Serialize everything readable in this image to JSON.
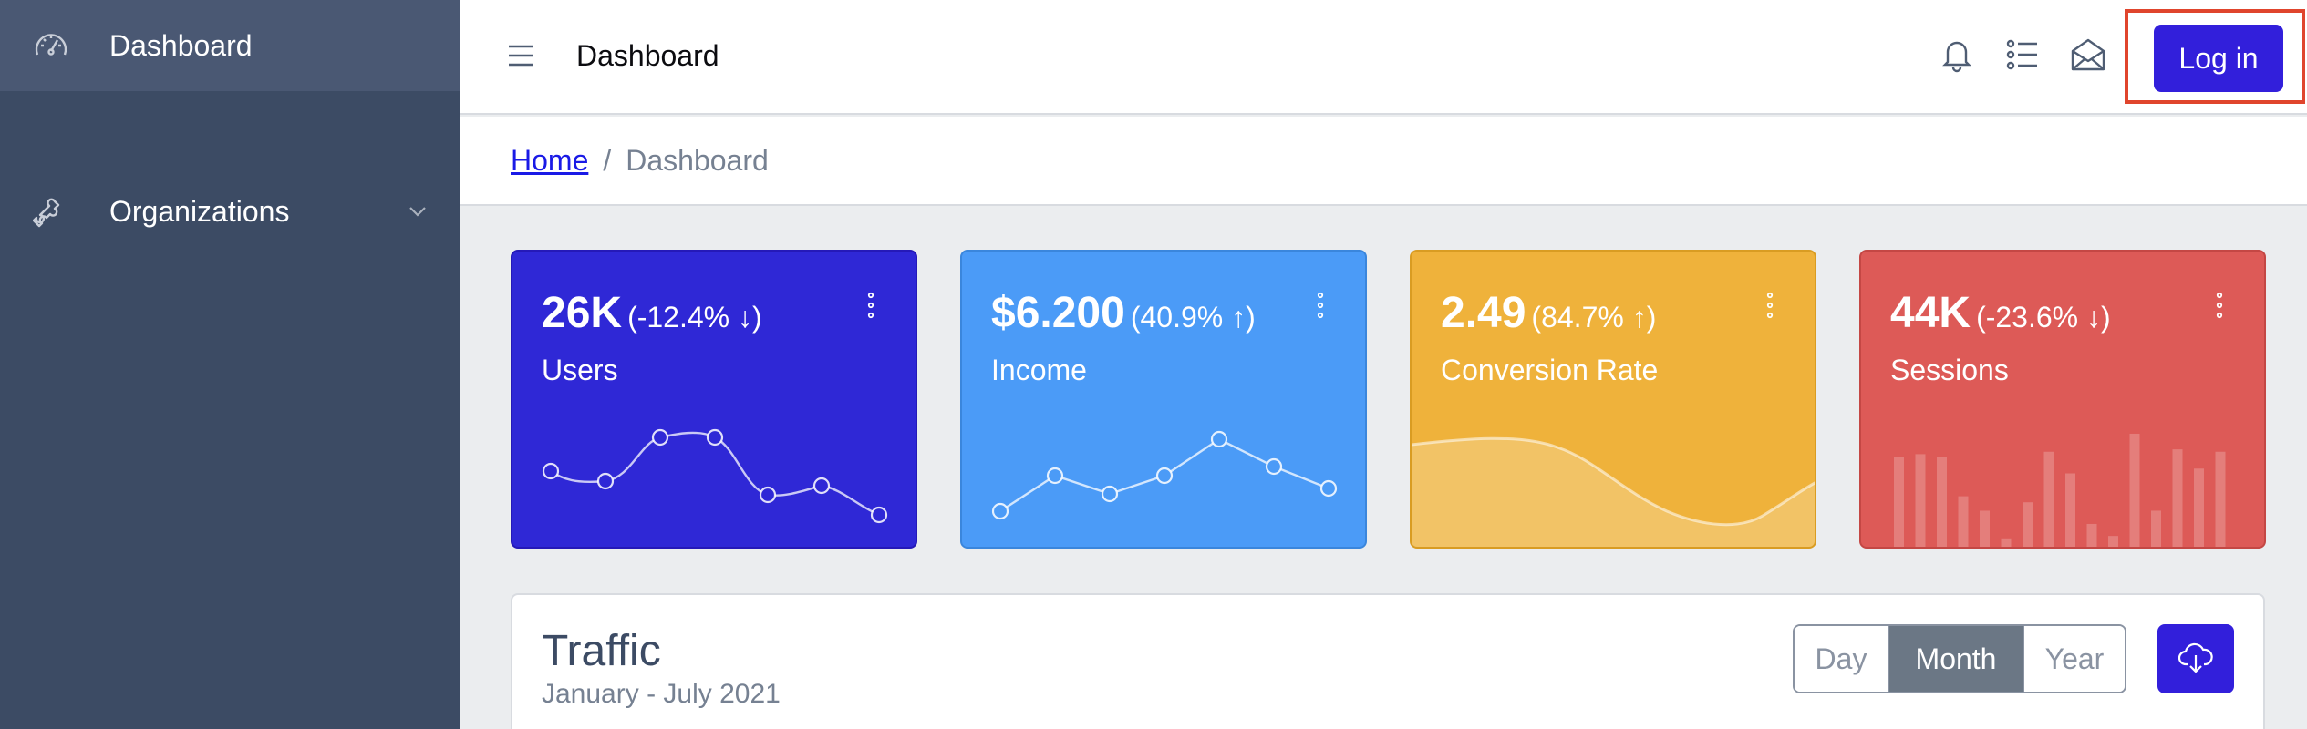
{
  "sidebar": {
    "items": [
      {
        "label": "Dashboard",
        "icon": "speedometer-icon",
        "active": true
      },
      {
        "label": "Organizations",
        "icon": "puzzle-icon",
        "expandable": true
      }
    ]
  },
  "header": {
    "title": "Dashboard",
    "login_label": "Log in",
    "icons": [
      "menu-icon",
      "bell-icon",
      "list-icon",
      "envelope-icon"
    ]
  },
  "breadcrumb": {
    "home": "Home",
    "separator": "/",
    "current": "Dashboard"
  },
  "cards": [
    {
      "value": "26K",
      "delta": "(-12.4% ↓)",
      "label": "Users",
      "color": "#2f28d6",
      "chart": "line",
      "points": [
        40,
        32,
        60,
        60,
        18,
        28,
        10
      ]
    },
    {
      "value": "$6.200",
      "delta": "(40.9% ↑)",
      "label": "Income",
      "color": "#4b9bf7",
      "chart": "line",
      "points": [
        10,
        30,
        18,
        28,
        45,
        28,
        18
      ]
    },
    {
      "value": "2.49",
      "delta": "(84.7% ↑)",
      "label": "Conversion Rate",
      "color": "#efb23b",
      "chart": "area"
    },
    {
      "value": "44K",
      "delta": "(-23.6% ↓)",
      "label": "Sessions",
      "color": "#dd5a57",
      "chart": "bar",
      "bars": [
        78,
        80,
        78,
        45,
        33,
        10,
        40,
        82,
        64,
        22,
        12,
        97,
        33,
        84,
        68,
        82
      ]
    }
  ],
  "traffic": {
    "title": "Traffic",
    "subtitle": "January - July 2021",
    "options": [
      "Day",
      "Month",
      "Year"
    ],
    "selected": "Month",
    "download_icon": "cloud-download-icon"
  }
}
